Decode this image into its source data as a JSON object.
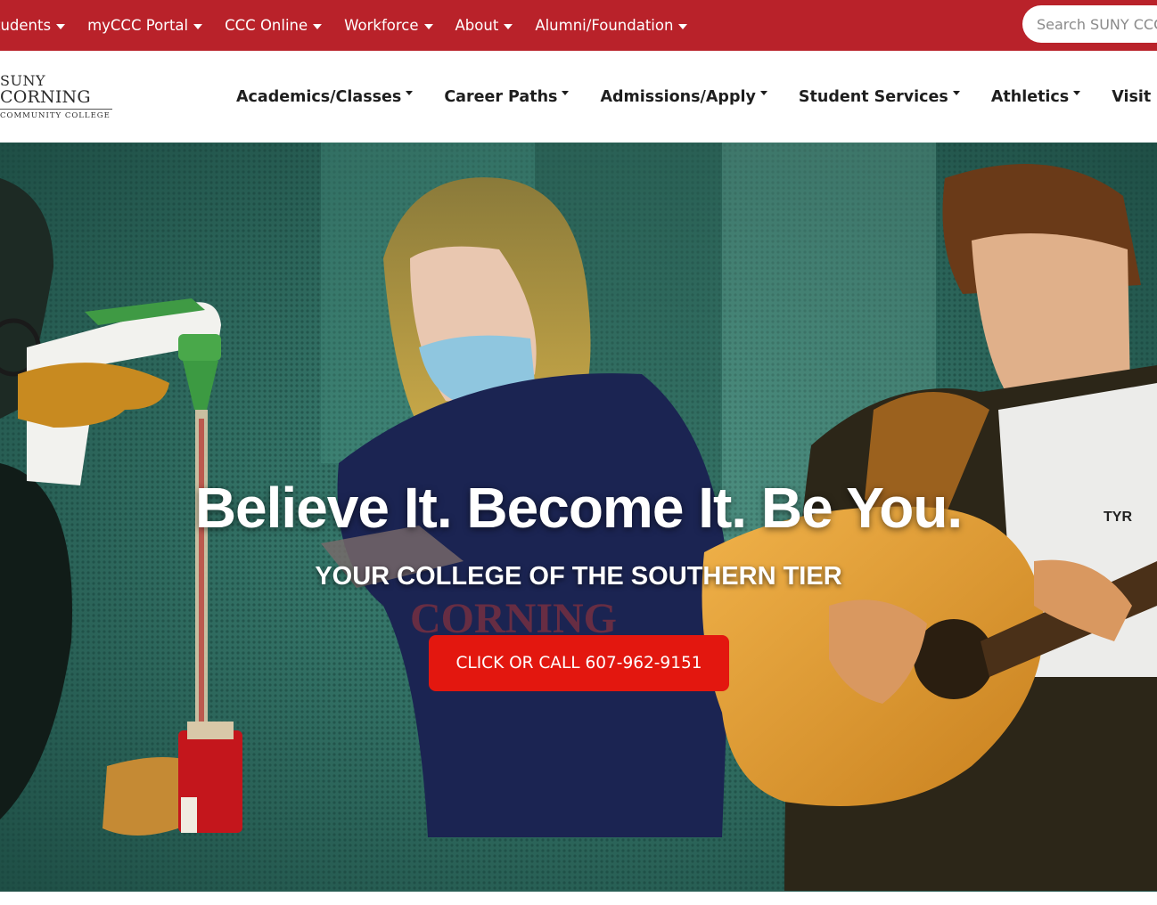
{
  "top_nav": {
    "items": [
      {
        "label": "tudents"
      },
      {
        "label": "myCCC Portal"
      },
      {
        "label": "CCC Online"
      },
      {
        "label": "Workforce"
      },
      {
        "label": "About"
      },
      {
        "label": "Alumni/Foundation"
      }
    ],
    "search_placeholder": "Search SUNY CCC"
  },
  "logo": {
    "line1": "SUNY",
    "line2": "CORNING",
    "line3": "COMMUNITY COLLEGE"
  },
  "main_nav": {
    "items": [
      {
        "label": "Academics/Classes"
      },
      {
        "label": "Career Paths"
      },
      {
        "label": "Admissions/Apply"
      },
      {
        "label": "Student Services"
      },
      {
        "label": "Athletics"
      },
      {
        "label": "Visit SUNY C"
      }
    ]
  },
  "hero": {
    "title": "Believe It. Become It. Be You.",
    "subtitle": "YOUR COLLEGE OF THE SOUTHERN TIER",
    "cta_label": "CLICK OR CALL 607-962-9151",
    "shirt_text": "TYR"
  },
  "colors": {
    "top_bar": "#b9222a",
    "cta": "#e3170f",
    "hero_bg": "#2e6a60"
  }
}
